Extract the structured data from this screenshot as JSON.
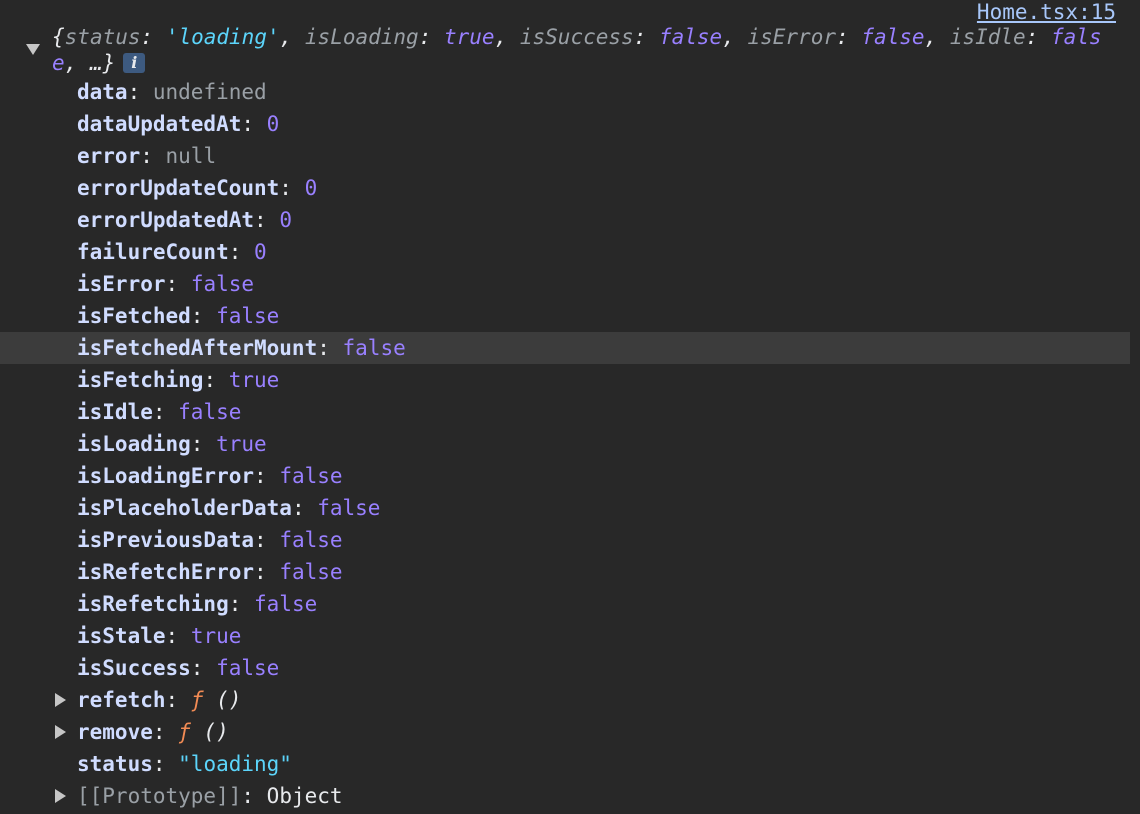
{
  "source_link": "Home.tsx:15",
  "summary": {
    "open": "{",
    "parts": [
      {
        "key": "status",
        "value": "'loading'",
        "type": "str"
      },
      {
        "key": "isLoading",
        "value": "true",
        "type": "bool"
      },
      {
        "key": "isSuccess",
        "value": "false",
        "type": "bool"
      },
      {
        "key": "isError",
        "value": "false",
        "type": "bool"
      },
      {
        "key": "isIdle",
        "value": "false",
        "type": "bool"
      }
    ],
    "ellipsis": "…",
    "close": "}",
    "info_badge": "i"
  },
  "properties": [
    {
      "key": "data",
      "value": "undefined",
      "type": "undef"
    },
    {
      "key": "dataUpdatedAt",
      "value": "0",
      "type": "num"
    },
    {
      "key": "error",
      "value": "null",
      "type": "null"
    },
    {
      "key": "errorUpdateCount",
      "value": "0",
      "type": "num"
    },
    {
      "key": "errorUpdatedAt",
      "value": "0",
      "type": "num"
    },
    {
      "key": "failureCount",
      "value": "0",
      "type": "num"
    },
    {
      "key": "isError",
      "value": "false",
      "type": "bool"
    },
    {
      "key": "isFetched",
      "value": "false",
      "type": "bool"
    },
    {
      "key": "isFetchedAfterMount",
      "value": "false",
      "type": "bool",
      "highlighted": true
    },
    {
      "key": "isFetching",
      "value": "true",
      "type": "bool"
    },
    {
      "key": "isIdle",
      "value": "false",
      "type": "bool"
    },
    {
      "key": "isLoading",
      "value": "true",
      "type": "bool"
    },
    {
      "key": "isLoadingError",
      "value": "false",
      "type": "bool"
    },
    {
      "key": "isPlaceholderData",
      "value": "false",
      "type": "bool"
    },
    {
      "key": "isPreviousData",
      "value": "false",
      "type": "bool"
    },
    {
      "key": "isRefetchError",
      "value": "false",
      "type": "bool"
    },
    {
      "key": "isRefetching",
      "value": "false",
      "type": "bool"
    },
    {
      "key": "isStale",
      "value": "true",
      "type": "bool"
    },
    {
      "key": "isSuccess",
      "value": "false",
      "type": "bool"
    },
    {
      "key": "refetch",
      "fn_label": "ƒ",
      "fn_parens": "()",
      "type": "fn",
      "expandable": true
    },
    {
      "key": "remove",
      "fn_label": "ƒ",
      "fn_parens": "()",
      "type": "fn",
      "expandable": true
    },
    {
      "key": "status",
      "value": "\"loading\"",
      "type": "str"
    },
    {
      "key": "[[Prototype]]",
      "value": "Object",
      "type": "obj",
      "expandable": true,
      "proto": true
    }
  ],
  "colors": {
    "background": "#282828",
    "highlight_row": "#3c3c3c",
    "key": "#d0dcff",
    "boolean_number": "#9980ff",
    "string": "#5cd5fb",
    "muted": "#9aa0a6",
    "function_f": "#f28b54",
    "link": "#a8c7fa",
    "info_badge_bg": "#3d5a80"
  }
}
